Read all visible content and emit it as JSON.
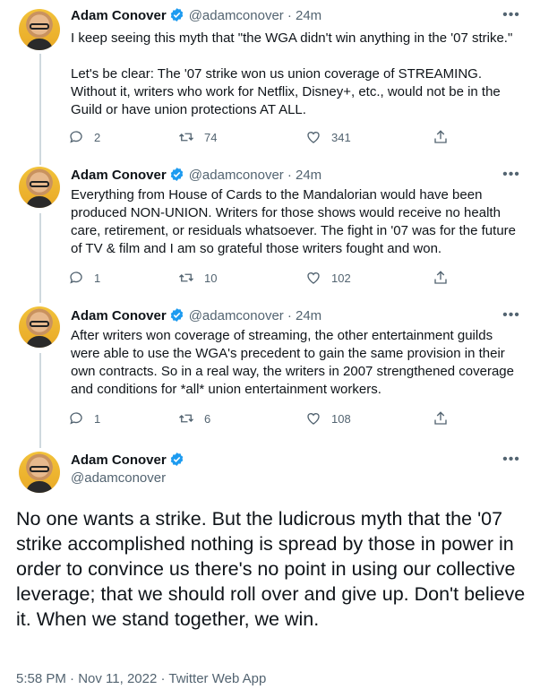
{
  "tweets": [
    {
      "name": "Adam Conover",
      "handle": "@adamconover",
      "time": "· 24m",
      "text": "I keep seeing this myth that \"the WGA didn't win anything in the '07 strike.\"\n\nLet's be clear: The '07 strike won us union coverage of STREAMING.\nWithout it, writers who work for Netflix, Disney+, etc., would not be in the\nGuild or have union protections AT ALL.",
      "replies": "2",
      "retweets": "74",
      "likes": "341"
    },
    {
      "name": "Adam Conover",
      "handle": "@adamconover",
      "time": "· 24m",
      "text": "Everything from House of Cards to the Mandalorian would have been\nproduced NON-UNION. Writers for those shows would receive no health\ncare, retirement, or residuals whatsoever. The fight in '07 was for the future\nof TV & film and I am so grateful those writers fought and won.",
      "replies": "1",
      "retweets": "10",
      "likes": "102"
    },
    {
      "name": "Adam Conover",
      "handle": "@adamconover",
      "time": "· 24m",
      "text": "After writers won coverage of streaming, the other entertainment guilds\nwere able to use the WGA's precedent to gain the same provision in their\nown contracts. So in a real way, the writers in 2007 strengthened coverage\nand conditions for *all* union entertainment workers.",
      "replies": "1",
      "retweets": "6",
      "likes": "108"
    }
  ],
  "main_tweet": {
    "name": "Adam Conover",
    "handle": "@adamconover",
    "text": "No one wants a strike. But the ludicrous myth that the '07 strike accomplished nothing is spread by those in power in order to convince us there's no point in using our collective leverage; that we should roll over and give up. Don't believe it. When we stand together, we win.",
    "timestamp": "5:58 PM · Nov 11, 2022 · ",
    "source": "Twitter Web App"
  },
  "icons": {
    "more": "more-horizontal-icon",
    "verified": "verified-badge-icon",
    "reply": "reply-icon",
    "retweet": "retweet-icon",
    "like": "heart-icon",
    "share": "share-icon"
  },
  "colors": {
    "verified": "#1d9bf0",
    "secondary_text": "#536471",
    "primary_text": "#0f1419",
    "thread_line": "#cfd9de"
  }
}
